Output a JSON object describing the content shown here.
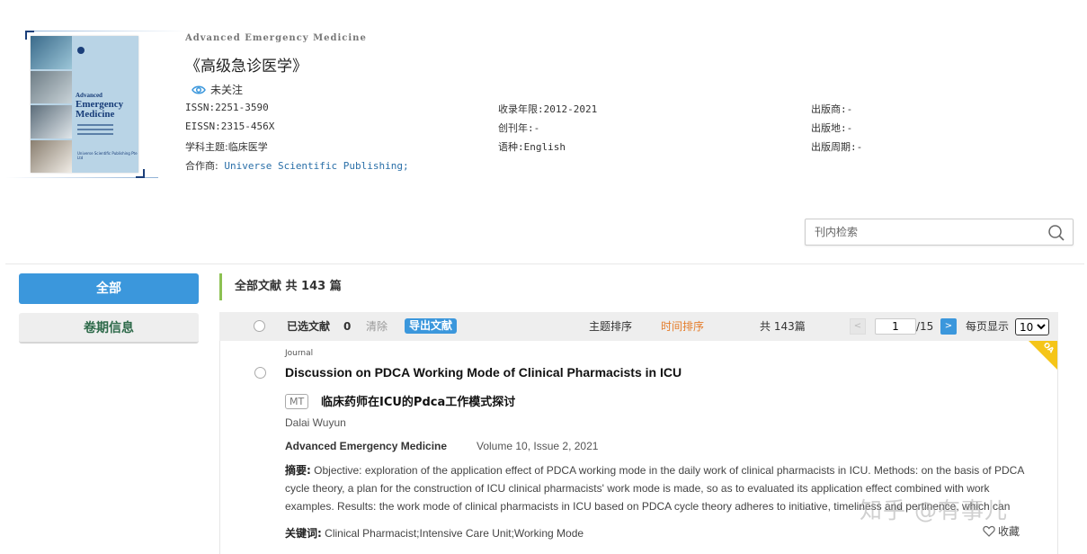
{
  "journal": {
    "name_en": "Advanced Emergency Medicine",
    "name_zh": "《高级急诊医学》",
    "follow_label": "未关注",
    "cover": {
      "line1": "Advanced",
      "line2": "Emergency",
      "line3": "Medicine",
      "publisher": "Universe Scientific Publishing Pte Ltd"
    },
    "meta": {
      "issn": "ISSN:2251-3590",
      "eissn": "EISSN:2315-456X",
      "subject": "学科主题:临床医学",
      "partner_label": "合作商:",
      "partner_value": "Universe Scientific Publishing;",
      "years": "收录年限:2012-2021",
      "founded": "创刊年:-",
      "language": "语种:English",
      "publisher": "出版商:-",
      "place": "出版地:-",
      "cycle": "出版周期:-"
    }
  },
  "search": {
    "placeholder": "刊内检索"
  },
  "sidebar": {
    "items": [
      {
        "label": "全部"
      },
      {
        "label": "卷期信息"
      }
    ]
  },
  "results": {
    "total_label": "全部文献 共 143 篇",
    "toolbar": {
      "selected_label": "已选文献",
      "selected_count": "0",
      "clear_label": "清除",
      "export_label": "导出文献",
      "sort_topic": "主题排序",
      "sort_time": "时间排序",
      "total": "共 143篇",
      "prev": "<",
      "page": "1",
      "pages": "/15",
      "next": ">",
      "per_page_label": "每页显示",
      "per_page_value": "10"
    },
    "items": [
      {
        "oa_badge": "OA",
        "type": "Journal",
        "title": "Discussion on PDCA Working Mode of Clinical Pharmacists in ICU",
        "mt_badge": "MT",
        "title_zh": "临床药师在ICU的Pdca工作模式探讨",
        "author": "Dalai Wuyun",
        "journal": "Advanced Emergency Medicine",
        "volume": "Volume 10, Issue 2, 2021",
        "abstract_label": "摘要:",
        "abstract": "Objective: exploration of the application effect of PDCA working mode in the daily work of clinical pharmacists in ICU. Methods: on the basis of PDCA cycle theory, a plan for the construction of ICU clinical pharmacists' work mode is made, so as to evaluated its application effect combined with work examples. Results: the work mode of clinical pharmacists in ICU based on PDCA cycle theory adheres to initiative, timeliness and pertinence, which can",
        "keywords_label": "关键词:",
        "keywords": "Clinical Pharmacist;Intensive Care Unit;Working Mode",
        "collect_label": "收藏"
      }
    ]
  },
  "watermark": "知乎 @有事儿",
  "colors": {
    "primary": "#3b97dc",
    "accent_orange": "#e57d2b",
    "oa_yellow": "#f5c518",
    "green_bar": "#8cc152"
  }
}
